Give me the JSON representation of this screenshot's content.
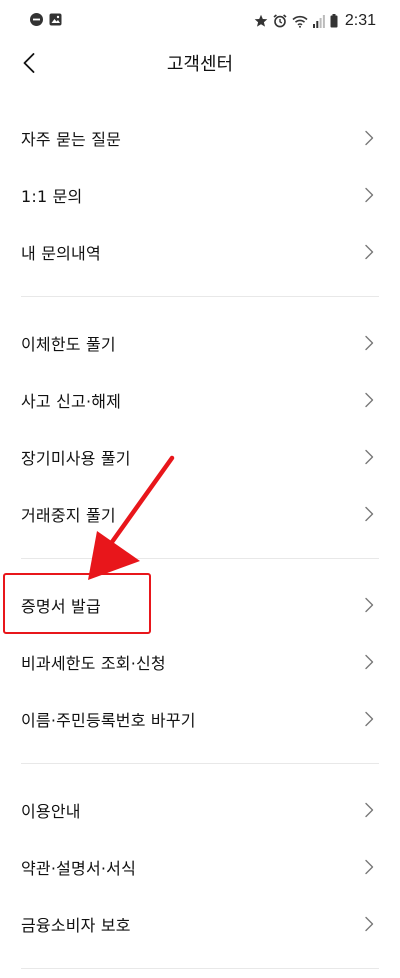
{
  "status_bar": {
    "time": "2:31"
  },
  "header": {
    "title": "고객센터"
  },
  "groups": [
    {
      "items": [
        {
          "label": "자주 묻는 질문"
        },
        {
          "label": "1:1 문의"
        },
        {
          "label": "내 문의내역"
        }
      ]
    },
    {
      "items": [
        {
          "label": "이체한도 풀기"
        },
        {
          "label": "사고 신고·해제"
        },
        {
          "label": "장기미사용 풀기"
        },
        {
          "label": "거래중지 풀기"
        }
      ]
    },
    {
      "items": [
        {
          "label": "증명서 발급"
        },
        {
          "label": "비과세한도 조회·신청"
        },
        {
          "label": "이름·주민등록번호 바꾸기"
        }
      ]
    },
    {
      "items": [
        {
          "label": "이용안내"
        },
        {
          "label": "약관·설명서·서식"
        },
        {
          "label": "금융소비자 보호"
        }
      ]
    }
  ],
  "annotation": {
    "highlight_color": "#e8161b",
    "arrow_color": "#e8161b"
  }
}
